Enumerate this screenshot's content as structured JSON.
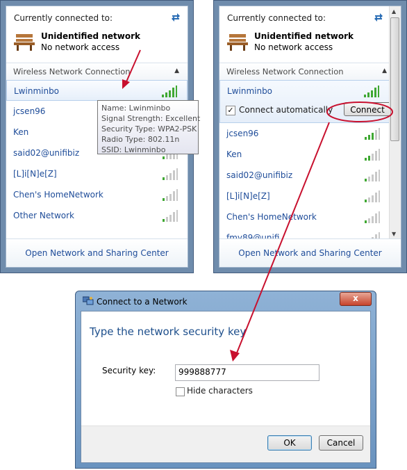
{
  "left_panel": {
    "header": "Currently connected to:",
    "connected": {
      "name": "Unidentified network",
      "status": "No network access"
    },
    "section": "Wireless Network Connection",
    "networks": [
      "Lwinminbo",
      "jcsen96",
      "Ken",
      "said02@unifibiz",
      "[L]i[N]e[Z]",
      "Chen's HomeNetwork",
      "Other Network"
    ],
    "tooltip": {
      "name": "Name: Lwinminbo",
      "signal": "Signal Strength: Excellent",
      "security": "Security Type: WPA2-PSK",
      "radio": "Radio Type: 802.11n",
      "ssid": "SSID: Lwinminbo"
    },
    "footer": "Open Network and Sharing Center"
  },
  "right_panel": {
    "header": "Currently connected to:",
    "connected": {
      "name": "Unidentified network",
      "status": "No network access"
    },
    "section": "Wireless Network Connection",
    "selected_network": "Lwinminbo",
    "connect_auto_label": "Connect automatically",
    "connect_button": "Connect",
    "networks": [
      "jcsen96",
      "Ken",
      "said02@unifibiz",
      "[L]i[N]e[Z]",
      "Chen's HomeNetwork",
      "fmy89@unifi"
    ],
    "footer": "Open Network and Sharing Center"
  },
  "dialog": {
    "title": "Connect to a Network",
    "heading": "Type the network security key",
    "key_label": "Security key:",
    "key_value": "999888777",
    "hide_label": "Hide characters",
    "ok": "OK",
    "cancel": "Cancel",
    "close": "x"
  },
  "colors": {
    "link": "#1e4c99",
    "annotation": "#c8102e",
    "frame": "#6f8cac"
  },
  "icons": [
    "refresh-icon",
    "bench-icon",
    "signal-icon",
    "collapse-icon",
    "network-dialog-icon"
  ]
}
